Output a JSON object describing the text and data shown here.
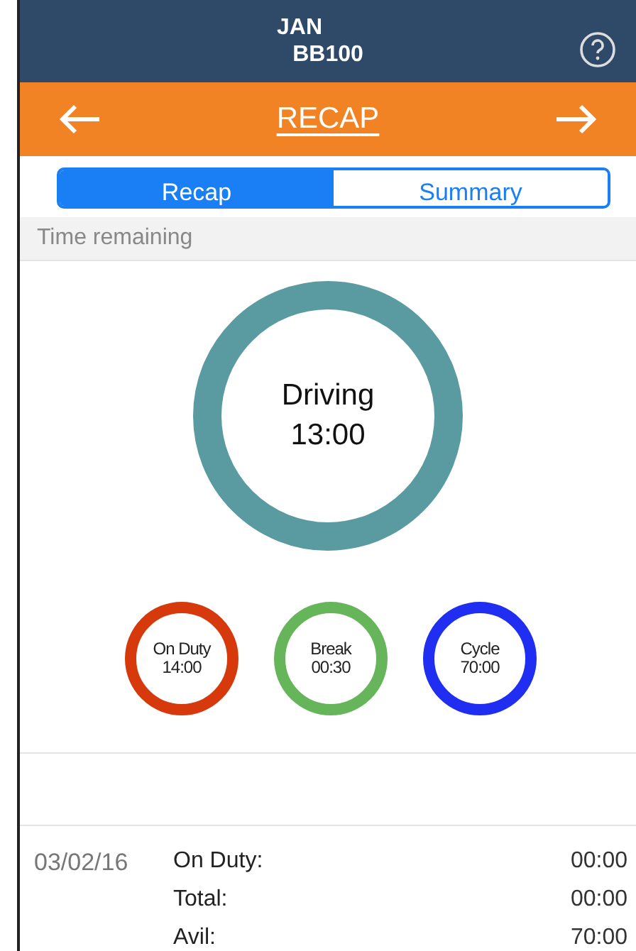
{
  "header": {
    "line_1": "JAN",
    "line_2": "BB100"
  },
  "nav": {
    "title": "RECAP"
  },
  "tabs": [
    {
      "label": "Recap",
      "selected": true
    },
    {
      "label": "Summary",
      "selected": false
    }
  ],
  "section": {
    "title": "Time remaining"
  },
  "main_ring": {
    "label": "Driving",
    "value": "13:00",
    "color": "#5a9aa1"
  },
  "rings": [
    {
      "label": "On Duty",
      "value": "14:00",
      "color": "#d63a0c"
    },
    {
      "label": "Break",
      "value": "00:30",
      "color": "#66b55a"
    },
    {
      "label": "Cycle",
      "value": "70:00",
      "color": "#1f2ef0"
    }
  ],
  "log": {
    "date": "03/02/16",
    "rows": [
      {
        "label": "On Duty:",
        "value": "00:00"
      },
      {
        "label": "Total:",
        "value": "00:00"
      },
      {
        "label": "Avil:",
        "value": "70:00"
      }
    ]
  }
}
